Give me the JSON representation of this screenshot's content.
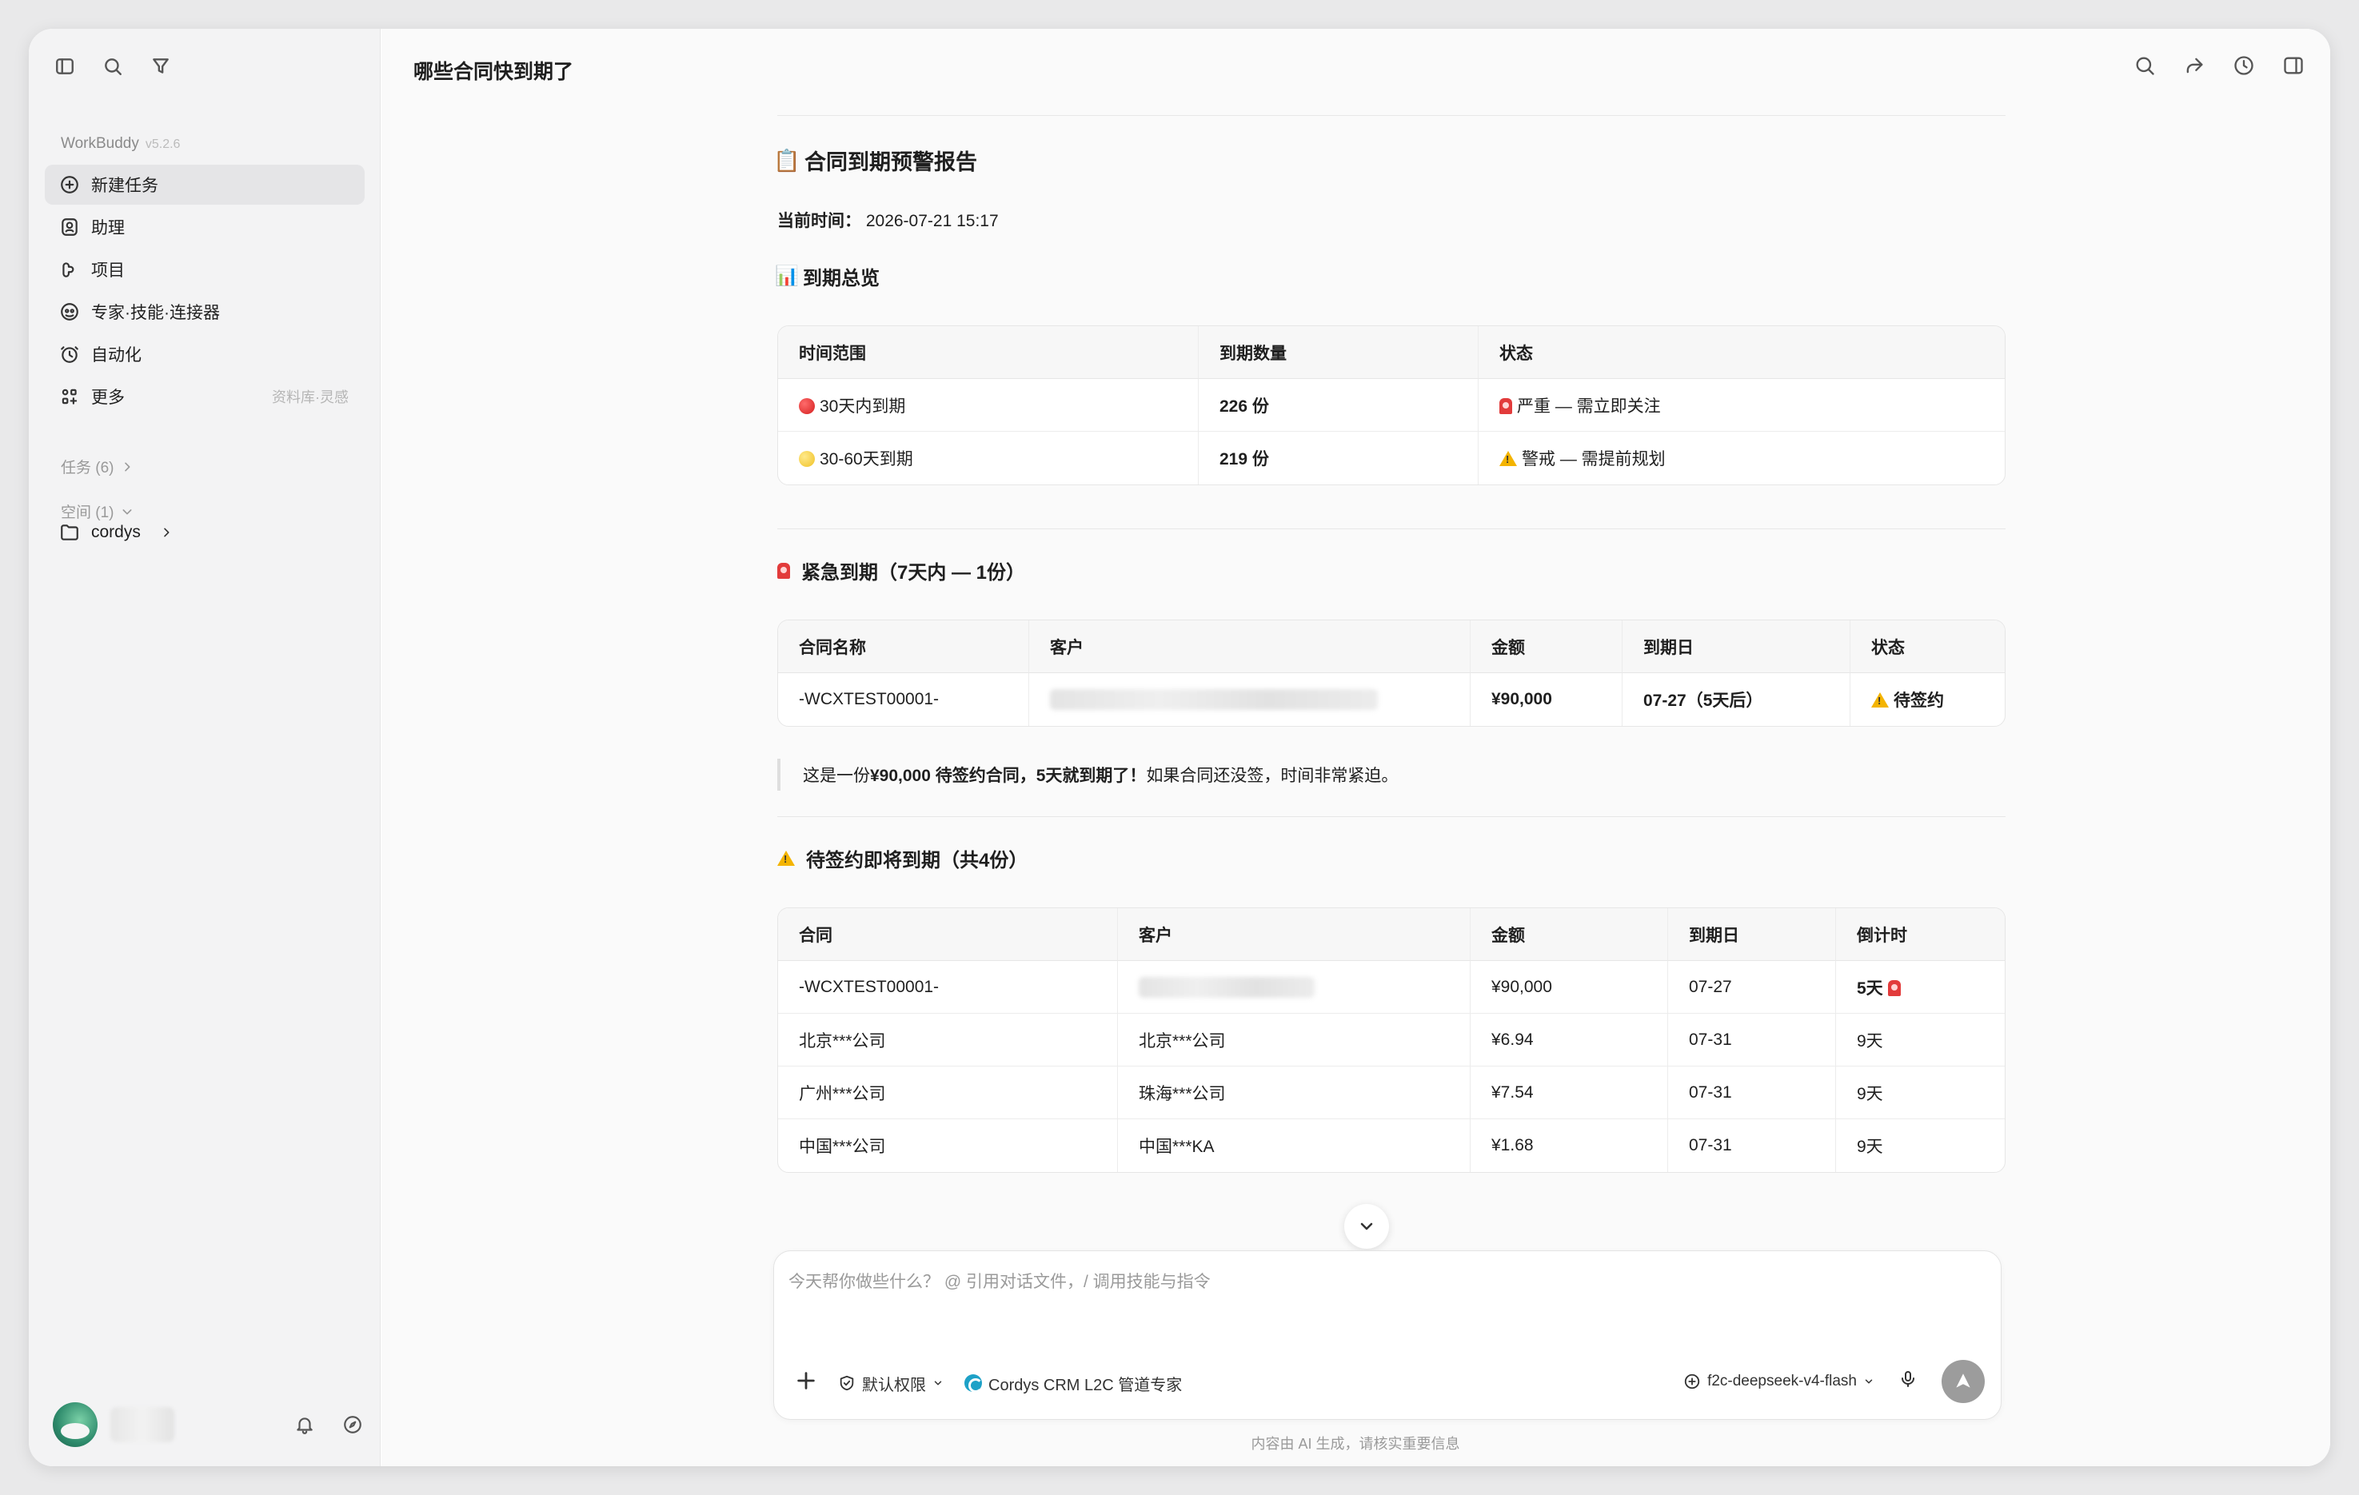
{
  "sidebar": {
    "brand": "WorkBuddy",
    "version": "v5.2.6",
    "nav": [
      {
        "label": "新建任务",
        "icon": "plus-circle-icon"
      },
      {
        "label": "助理",
        "icon": "assistant-icon"
      },
      {
        "label": "项目",
        "icon": "project-icon"
      },
      {
        "label": "专家·技能·连接器",
        "icon": "expert-icon"
      },
      {
        "label": "自动化",
        "icon": "clock-icon"
      },
      {
        "label": "更多",
        "icon": "grid-icon",
        "extra": "资料库·灵感"
      }
    ],
    "tasks_label": "任务 (6)",
    "spaces_label": "空间 (1)",
    "folder": "cordys"
  },
  "header": {
    "title": "哪些合同快到期了"
  },
  "report": {
    "title": "合同到期预警报告",
    "title_icon": "📋",
    "time_label": "当前时间：",
    "time_value": "2026-07-21 15:17",
    "overview": {
      "heading": "到期总览",
      "heading_icon": "📊",
      "columns": [
        "时间范围",
        "到期数量",
        "状态"
      ],
      "rows": [
        {
          "range": "30天内到期",
          "dot": "red",
          "count": "226 份",
          "status_icon": "siren",
          "status": "严重 — 需立即关注"
        },
        {
          "range": "30-60天到期",
          "dot": "yellow",
          "count": "219 份",
          "status_icon": "warning",
          "status": "警戒 — 需提前规划"
        }
      ]
    },
    "urgent": {
      "heading": "紧急到期（7天内 — 1份）",
      "heading_icon": "🚨",
      "columns": [
        "合同名称",
        "客户",
        "金额",
        "到期日",
        "状态"
      ],
      "rows": [
        {
          "name": "-WCXTEST00001-",
          "customer": "",
          "amount": "¥90,000",
          "due": "07-27（5天后）",
          "status": "待签约"
        }
      ],
      "note_pre": "这是一份 ",
      "note_bold": "¥90,000 待签约合同，5天就到期了！",
      "note_post": " 如果合同还没签，时间非常紧迫。"
    },
    "pending": {
      "heading": "待签约即将到期（共4份）",
      "heading_icon": "⚠️",
      "columns": [
        "合同",
        "客户",
        "金额",
        "到期日",
        "倒计时"
      ],
      "rows": [
        {
          "name": "-WCXTEST00001-",
          "customer": "",
          "amount": "¥90,000",
          "due": "07-27",
          "countdown": "5天",
          "bold": true,
          "siren": true
        },
        {
          "name": "北京***公司",
          "customer": "北京***公司",
          "amount": "¥6.94",
          "due": "07-31",
          "countdown": "9天"
        },
        {
          "name": "广州***公司",
          "customer": "珠海***公司",
          "amount": "¥7.54",
          "due": "07-31",
          "countdown": "9天"
        },
        {
          "name": "中国***公司",
          "customer": "中国***KA",
          "amount": "¥1.68",
          "due": "07-31",
          "countdown": "9天"
        }
      ]
    }
  },
  "composer": {
    "placeholder": "今天帮你做些什么？ @ 引用对话文件，/ 调用技能与指令",
    "permission": "默认权限",
    "agent": "Cordys CRM L2C 管道专家",
    "model": "f2c-deepseek-v4-flash"
  },
  "footer": "内容由 AI 生成，请核实重要信息",
  "colors": {
    "accent": "#1ea1c7",
    "danger": "#e23b3b",
    "warning": "#f4b400"
  }
}
